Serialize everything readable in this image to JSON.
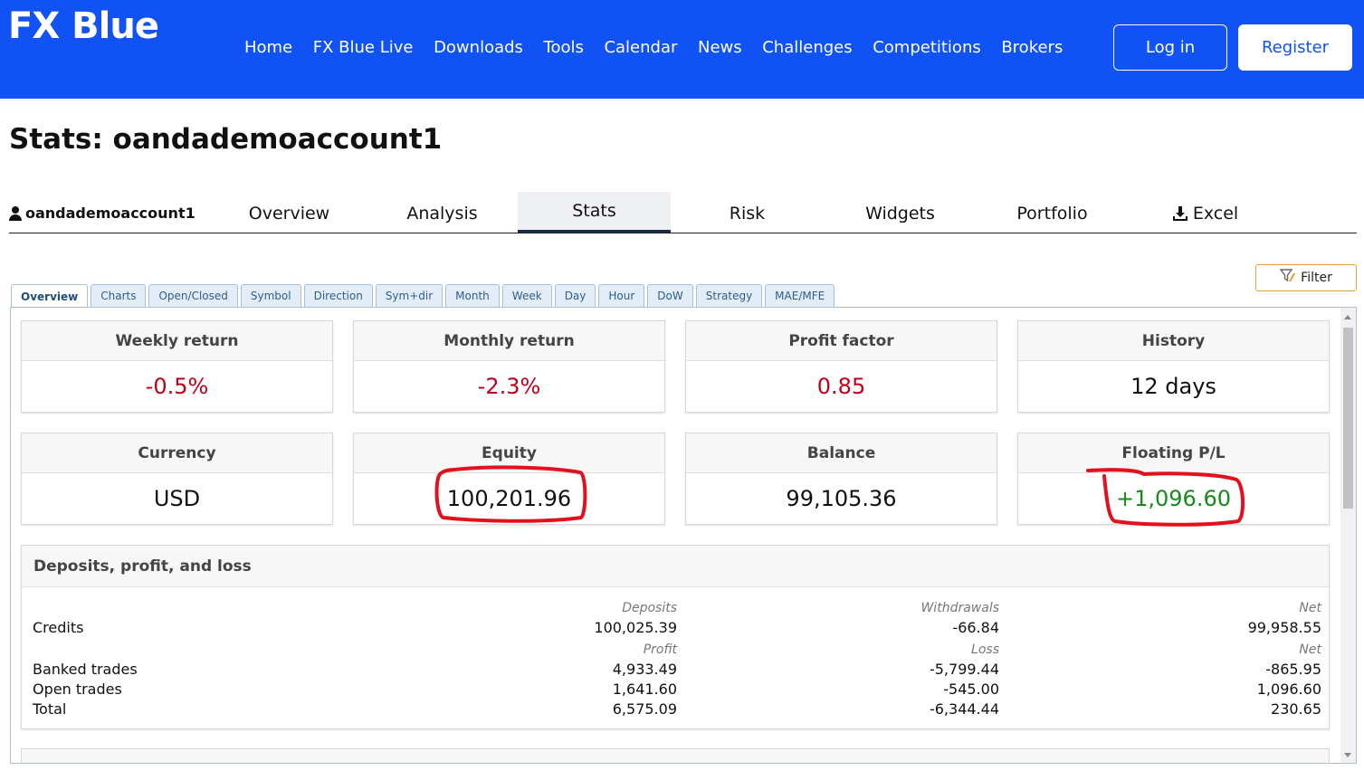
{
  "header": {
    "logo_fx": "FX",
    "logo_blue": "Blue",
    "nav": [
      "Home",
      "FX Blue Live",
      "Downloads",
      "Tools",
      "Calendar",
      "News",
      "Challenges",
      "Competitions",
      "Brokers"
    ],
    "login": "Log in",
    "register": "Register"
  },
  "page": {
    "title": "Stats: oandademoaccount1"
  },
  "tabs": {
    "account": "oandademoaccount1",
    "items": [
      "Overview",
      "Analysis",
      "Stats",
      "Risk",
      "Widgets",
      "Portfolio",
      "Excel"
    ],
    "active": "Stats"
  },
  "subtabs": {
    "items": [
      "Overview",
      "Charts",
      "Open/Closed",
      "Symbol",
      "Direction",
      "Sym+dir",
      "Month",
      "Week",
      "Day",
      "Hour",
      "DoW",
      "Strategy",
      "MAE/MFE"
    ],
    "active": "Overview",
    "filter": "Filter"
  },
  "cards": [
    {
      "label": "Weekly return",
      "value": "-0.5%"
    },
    {
      "label": "Monthly return",
      "value": "-2.3%"
    },
    {
      "label": "Profit factor",
      "value": "0.85"
    },
    {
      "label": "History",
      "value": "12 days"
    },
    {
      "label": "Currency",
      "value": "USD"
    },
    {
      "label": "Equity",
      "value": "100,201.96"
    },
    {
      "label": "Balance",
      "value": "99,105.36"
    },
    {
      "label": "Floating P/L",
      "value": "+1,096.60"
    }
  ],
  "colors": {
    "header_bg": "#1152f5",
    "negative": "#c0001a",
    "positive": "#188a1c",
    "annotation": "#e3101e"
  },
  "dpl": {
    "title": "Deposits, profit, and loss",
    "head1": [
      "Deposits",
      "Withdrawals",
      "Net"
    ],
    "credits": [
      "Credits",
      "100,025.39",
      "-66.84",
      "99,958.55"
    ],
    "head2": [
      "Profit",
      "Loss",
      "Net"
    ],
    "banked": [
      "Banked trades",
      "4,933.49",
      "-5,799.44",
      "-865.95"
    ],
    "open": [
      "Open trades",
      "1,641.60",
      "-545.00",
      "1,096.60"
    ],
    "total": [
      "Total",
      "6,575.09",
      "-6,344.44",
      "230.65"
    ]
  }
}
